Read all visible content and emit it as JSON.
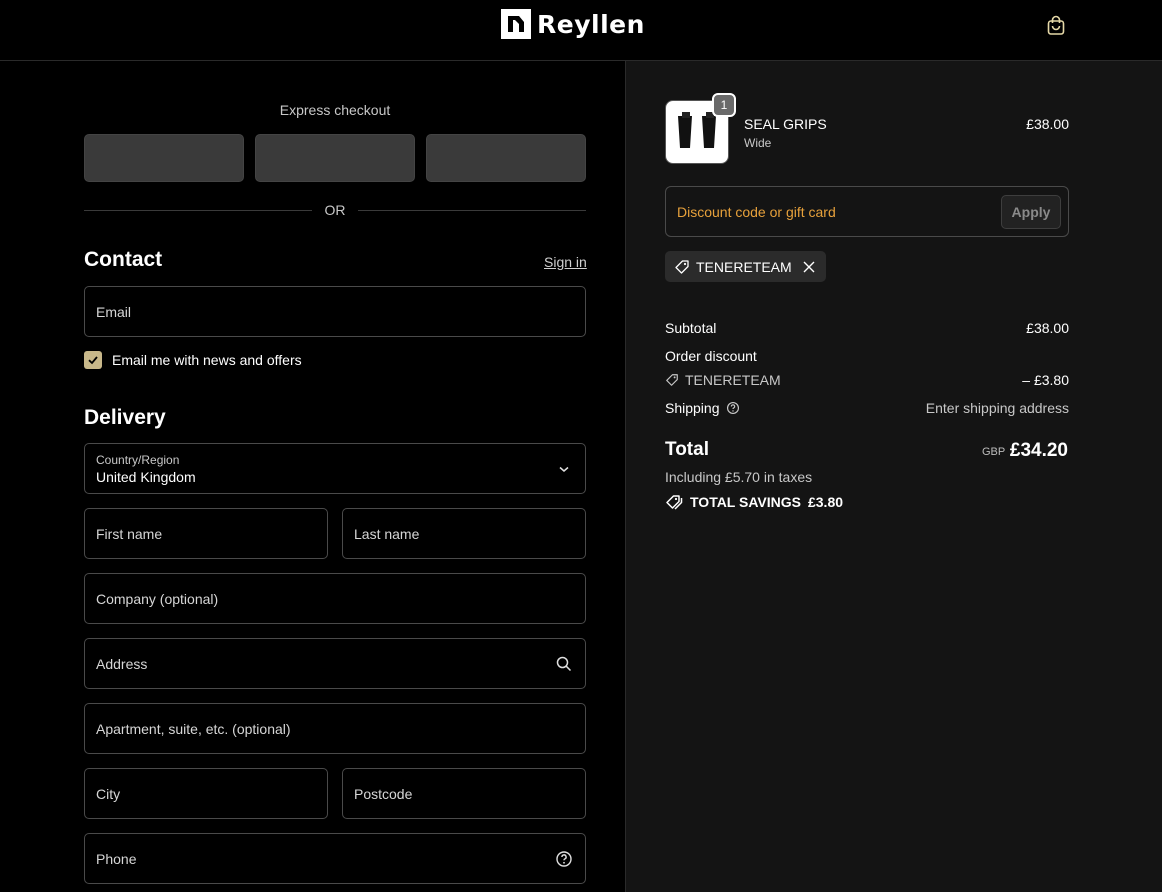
{
  "brand": {
    "name": "Reyllen"
  },
  "header": {
    "cart_icon": "bag-icon"
  },
  "express": {
    "title": "Express checkout",
    "divider": "OR"
  },
  "contact": {
    "title": "Contact",
    "sign_in": "Sign in",
    "email_placeholder": "Email",
    "newsletter_label": "Email me with news and offers",
    "newsletter_checked": true
  },
  "delivery": {
    "title": "Delivery",
    "country_label": "Country/Region",
    "country_value": "United Kingdom",
    "first_name": "First name",
    "last_name": "Last name",
    "company": "Company (optional)",
    "address": "Address",
    "apartment": "Apartment, suite, etc. (optional)",
    "city": "City",
    "postcode": "Postcode",
    "phone": "Phone"
  },
  "order": {
    "item": {
      "name": "SEAL GRIPS",
      "variant": "Wide",
      "price": "£38.00",
      "quantity": "1"
    },
    "discount_placeholder": "Discount code or gift card",
    "apply_label": "Apply",
    "applied_code": "TENERETEAM",
    "subtotal_label": "Subtotal",
    "subtotal_value": "£38.00",
    "order_discount_label": "Order discount",
    "discount_code": "TENERETEAM",
    "discount_value": "– £3.80",
    "shipping_label": "Shipping",
    "shipping_value": "Enter shipping address",
    "total_label": "Total",
    "currency": "GBP",
    "total_value": "£34.20",
    "tax_note": "Including £5.70 in taxes",
    "savings_label": "TOTAL SAVINGS",
    "savings_value": "£3.80"
  },
  "colors": {
    "accent_checkbox": "#c8b88a",
    "discount_placeholder": "#e7a13b",
    "panel_right": "#141414"
  }
}
